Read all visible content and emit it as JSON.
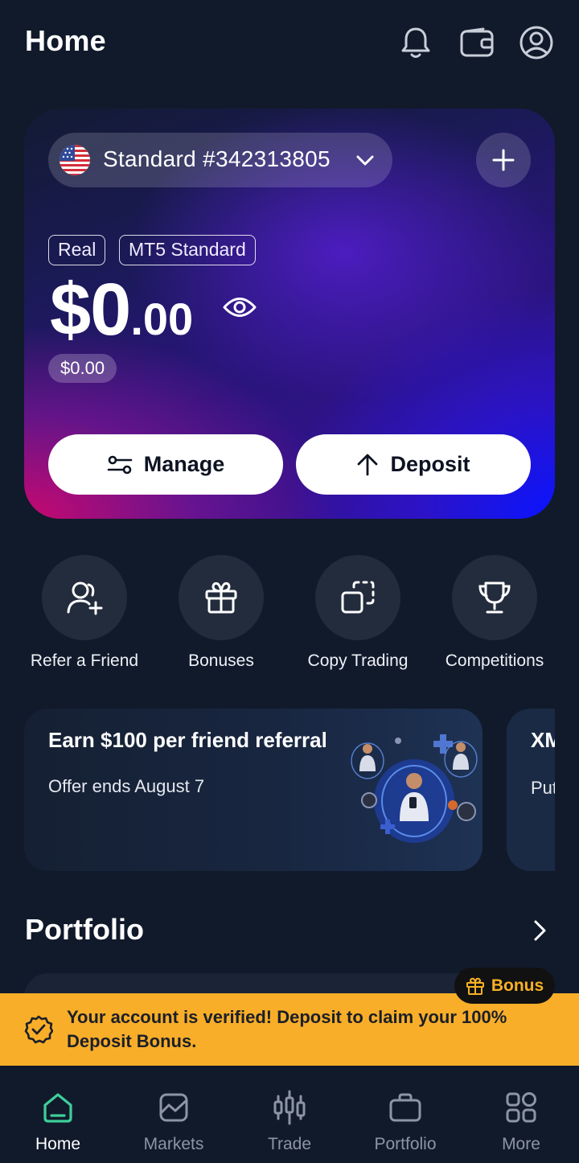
{
  "header": {
    "title": "Home"
  },
  "account_card": {
    "account_name": "Standard #342313805",
    "tags": [
      "Real",
      "MT5 Standard"
    ],
    "balance_main": "$0",
    "balance_decimal": ".00",
    "sub_balance": "$0.00",
    "manage_label": "Manage",
    "deposit_label": "Deposit"
  },
  "quick_actions": [
    {
      "label": "Refer a Friend",
      "icon": "refer-friend-icon"
    },
    {
      "label": "Bonuses",
      "icon": "gift-icon"
    },
    {
      "label": "Copy Trading",
      "icon": "copy-trading-icon"
    },
    {
      "label": "Competitions",
      "icon": "trophy-icon"
    }
  ],
  "promos": [
    {
      "title": "Earn $100 per friend referral",
      "subtitle": "Offer ends August 7"
    },
    {
      "title": "XM",
      "subtitle": "Put big"
    }
  ],
  "portfolio": {
    "title": "Portfolio"
  },
  "bonus_badge": "Bonus",
  "verify_banner": {
    "text": "Your account is verified! Deposit to claim your 100% Deposit Bonus."
  },
  "bottom_nav": [
    {
      "label": "Home",
      "active": true
    },
    {
      "label": "Markets",
      "active": false
    },
    {
      "label": "Trade",
      "active": false
    },
    {
      "label": "Portfolio",
      "active": false
    },
    {
      "label": "More",
      "active": false
    }
  ],
  "colors": {
    "background": "#111a2b",
    "accent_green": "#3ecf9a",
    "banner_yellow": "#f9ae29",
    "bonus_orange": "#f8b124"
  }
}
